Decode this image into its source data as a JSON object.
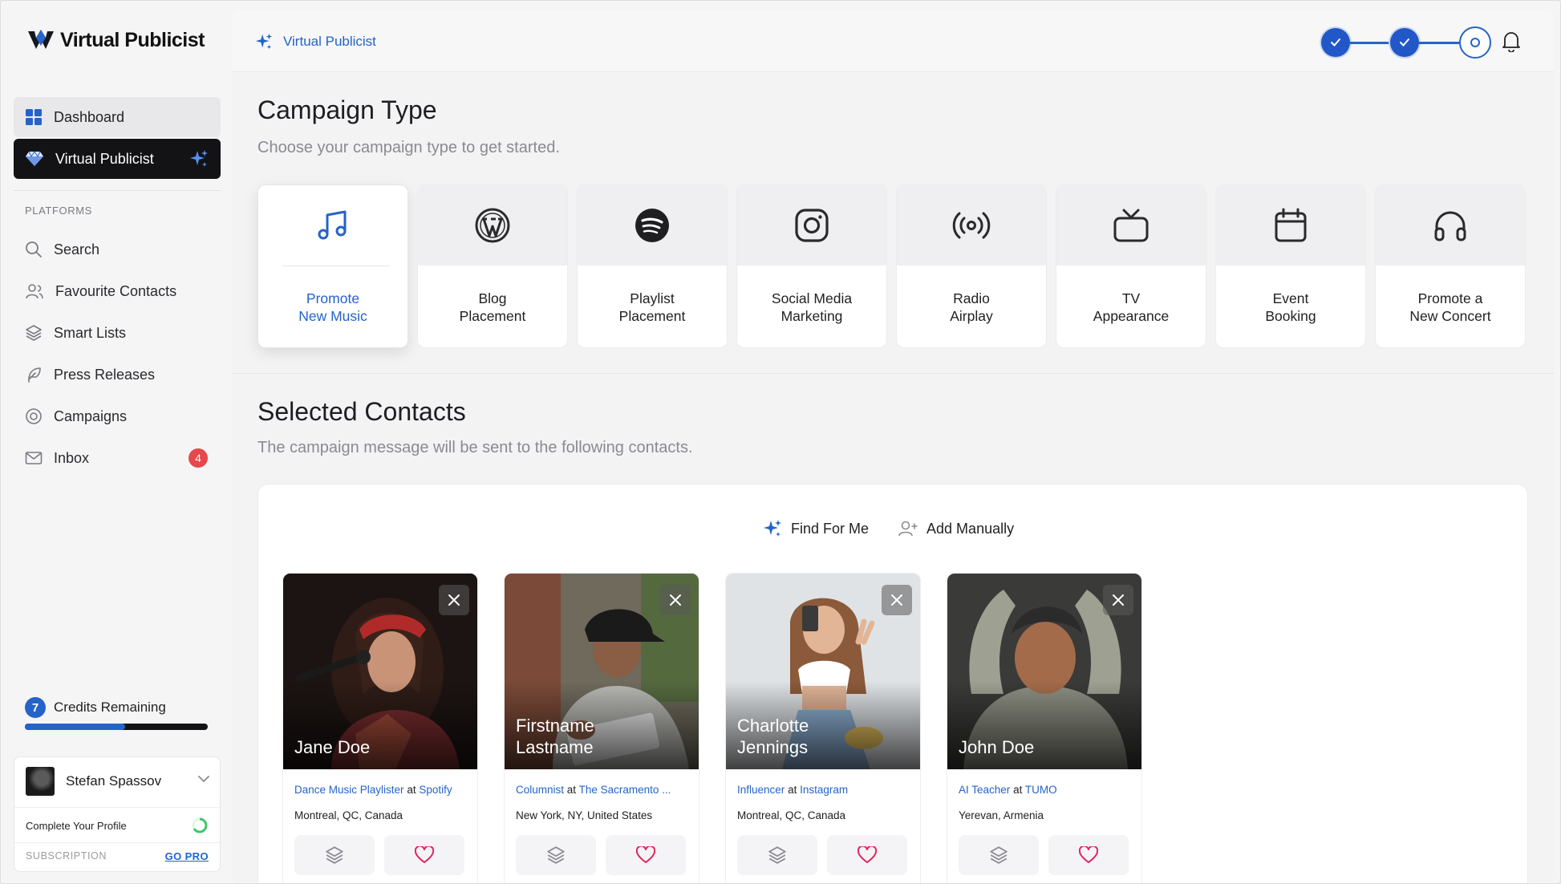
{
  "app": {
    "brand": "Virtual Publicist"
  },
  "sidebar": {
    "dashboard": "Dashboard",
    "virtual_publicist": "Virtual Publicist",
    "section_label": "PLATFORMS",
    "items": [
      {
        "label": "Search",
        "icon": "search-icon"
      },
      {
        "label": "Favourite Contacts",
        "icon": "users-icon"
      },
      {
        "label": "Smart Lists",
        "icon": "layers-icon"
      },
      {
        "label": "Press Releases",
        "icon": "feather-icon"
      },
      {
        "label": "Campaigns",
        "icon": "target-icon"
      },
      {
        "label": "Inbox",
        "icon": "mail-icon",
        "badge": "4"
      }
    ],
    "credits": {
      "count": "7",
      "label": "Credits Remaining",
      "fraction": 0.55
    },
    "profile": {
      "name": "Stefan Spassov",
      "complete_label": "Complete Your Profile",
      "subscription_label": "SUBSCRIPTION",
      "go_pro": "GO PRO"
    }
  },
  "topbar": {
    "breadcrumb": "Virtual Publicist",
    "steps": [
      "done",
      "done",
      "current"
    ]
  },
  "campaign": {
    "title": "Campaign Type",
    "subtitle": "Choose your campaign type to get started.",
    "types": [
      {
        "label": "Promote\nNew Music",
        "icon": "music-note-icon",
        "active": true
      },
      {
        "label": "Blog\nPlacement",
        "icon": "wordpress-icon"
      },
      {
        "label": "Playlist\nPlacement",
        "icon": "spotify-icon"
      },
      {
        "label": "Social Media\nMarketing",
        "icon": "instagram-icon"
      },
      {
        "label": "Radio\nAirplay",
        "icon": "radio-broadcast-icon"
      },
      {
        "label": "TV\nAppearance",
        "icon": "tv-icon"
      },
      {
        "label": "Event\nBooking",
        "icon": "calendar-icon"
      },
      {
        "label": "Promote a\nNew Concert",
        "icon": "headphones-icon"
      }
    ]
  },
  "contacts": {
    "title": "Selected Contacts",
    "subtitle": "The campaign message will be sent to the following contacts.",
    "find_for_me": "Find For Me",
    "add_manually": "Add Manually",
    "at": "at",
    "cards": [
      {
        "name": "Jane Doe",
        "role": "Dance Music Playlister",
        "company": "Spotify",
        "location": "Montreal, QC, Canada"
      },
      {
        "name": "Firstname\nLastname",
        "role": "Columnist",
        "company": "The Sacramento ...",
        "location": "New York, NY, United States"
      },
      {
        "name": "Charlotte\nJennings",
        "role": "Influencer",
        "company": "Instagram",
        "location": "Montreal, QC, Canada"
      },
      {
        "name": "John Doe",
        "role": "AI Teacher",
        "company": "TUMO",
        "location": "Yerevan, Armenia"
      }
    ]
  },
  "colors": {
    "accent": "#2563c9",
    "dark": "#131316",
    "badge": "#e5484d",
    "heart": "#e0245e"
  }
}
